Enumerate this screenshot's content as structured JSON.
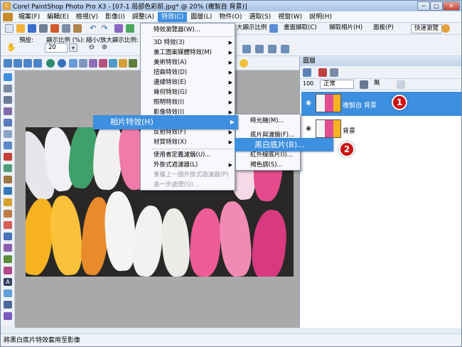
{
  "window": {
    "title": "Corel PaintShop Photo Pro X3 - [07-1 局部色彩前.jpg* @ 20% (複製自 背景)]",
    "controls": [
      "─",
      "□",
      "✕"
    ]
  },
  "menubar": {
    "items": [
      "檔案(F)",
      "編輯(E)",
      "檢視(V)",
      "影像(I)",
      "調整(A)",
      "特效(C)",
      "圖層(L)",
      "物件(O)",
      "選取(S)",
      "視窗(W)",
      "說明(H)"
    ],
    "active": "特效(C)"
  },
  "toolbar": {
    "right_buttons": [
      "大顯示比例",
      "畫面擷取(C)",
      "擷取相片(H)",
      "面板(P)"
    ],
    "layout_select": "快速瀏覽"
  },
  "tool_options": {
    "preset_label": "預設:",
    "zoom_label": "顯示比例 (%):",
    "zoom_value": "20",
    "zoom_in_out_label": "縮小/放大顯示比例:"
  },
  "effects_menu": {
    "items": [
      {
        "label": "特效瀏覽器(W)...",
        "submenu": false
      },
      {
        "label": "3D 特效(3)",
        "submenu": true
      },
      {
        "label": "美工圖案媒體特效(M)",
        "submenu": true
      },
      {
        "label": "美術特效(A)",
        "submenu": true
      },
      {
        "label": "扭曲特效(D)",
        "submenu": true
      },
      {
        "label": "邊緣特效(E)",
        "submenu": true
      },
      {
        "label": "幾何特效(G)",
        "submenu": true
      },
      {
        "label": "照明特效(I)",
        "submenu": true
      },
      {
        "label": "影像特效(I)",
        "submenu": true
      },
      {
        "label": "相片特效(H)",
        "submenu": true
      },
      {
        "label": "反射特效(F)",
        "submenu": true
      },
      {
        "label": "材質特效(X)",
        "submenu": true
      },
      {
        "label": "使用者定義濾鏡(U)...",
        "submenu": false
      },
      {
        "label": "外掛式過濾器(L)",
        "submenu": true
      },
      {
        "label": "重複上一個外掛式過濾器(P)",
        "submenu": false,
        "disabled": true
      },
      {
        "label": "進一步處理(O)...",
        "submenu": false,
        "disabled": true
      }
    ],
    "highlighted": "相片特效(H)"
  },
  "photo_submenu": {
    "items": [
      "時光機(M)...",
      "底片與濾鏡(F)...",
      "黑白底片(B)...",
      "紅外線底片(I)...",
      "褐色調(S)..."
    ],
    "highlighted": "黑白底片(B)..."
  },
  "layers_panel": {
    "title": "圖層",
    "blend_mode": "正常",
    "opacity": "100",
    "mask_label": "無",
    "layers": [
      {
        "name": "複製自 背景",
        "selected": true
      },
      {
        "name": "背景",
        "selected": false
      }
    ]
  },
  "callouts": [
    "1",
    "2"
  ],
  "status": "將黑白底片特效套用至影像",
  "colors": {
    "highlight": "#3d8fe0",
    "badge": "#cc1212"
  }
}
